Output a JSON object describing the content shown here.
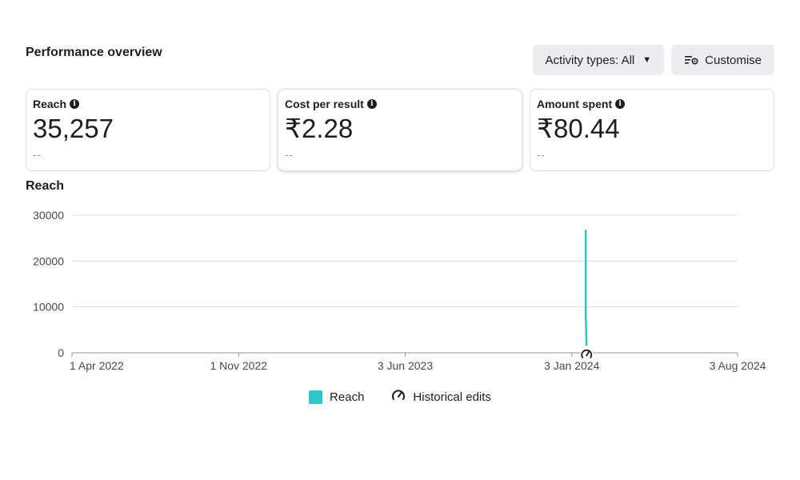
{
  "header": {
    "title": "Performance overview"
  },
  "toolbar": {
    "activity_label": "Activity types: All",
    "customise_label": "Customise"
  },
  "cards": [
    {
      "label": "Reach",
      "value": "35,257",
      "compare": "--"
    },
    {
      "label": "Cost per result",
      "value": "₹2.28",
      "compare": "--"
    },
    {
      "label": "Amount spent",
      "value": "₹80.44",
      "compare": "--"
    }
  ],
  "icons": {
    "info": "info-circle-icon",
    "caret": "caret-down-icon",
    "customise": "sliders-icon",
    "historical": "gauge-icon"
  },
  "chart_title": "Reach",
  "chart_data": {
    "type": "line",
    "x_ticks": [
      "1 Apr 2022",
      "1 Nov 2022",
      "3 Jun 2023",
      "3 Jan 2024",
      "3 Aug 2024"
    ],
    "y_ticks": [
      0,
      10000,
      20000,
      30000
    ],
    "ylim": [
      0,
      30000
    ],
    "series": [
      {
        "name": "Reach",
        "color": "#2ec7c9",
        "points": [
          {
            "x": "2024-01-21",
            "y": 26800
          },
          {
            "x": "2024-01-21",
            "y": 8000
          },
          {
            "x": "2024-01-22",
            "y": 1500
          }
        ]
      }
    ],
    "historical_edits": [
      "2024-01-22"
    ],
    "grid": true
  },
  "legend": {
    "reach_label": "Reach",
    "historical_label": "Historical edits"
  },
  "colors": {
    "accent": "#2ec7c9",
    "grid": "#dadde1",
    "axis_text": "#444950"
  }
}
